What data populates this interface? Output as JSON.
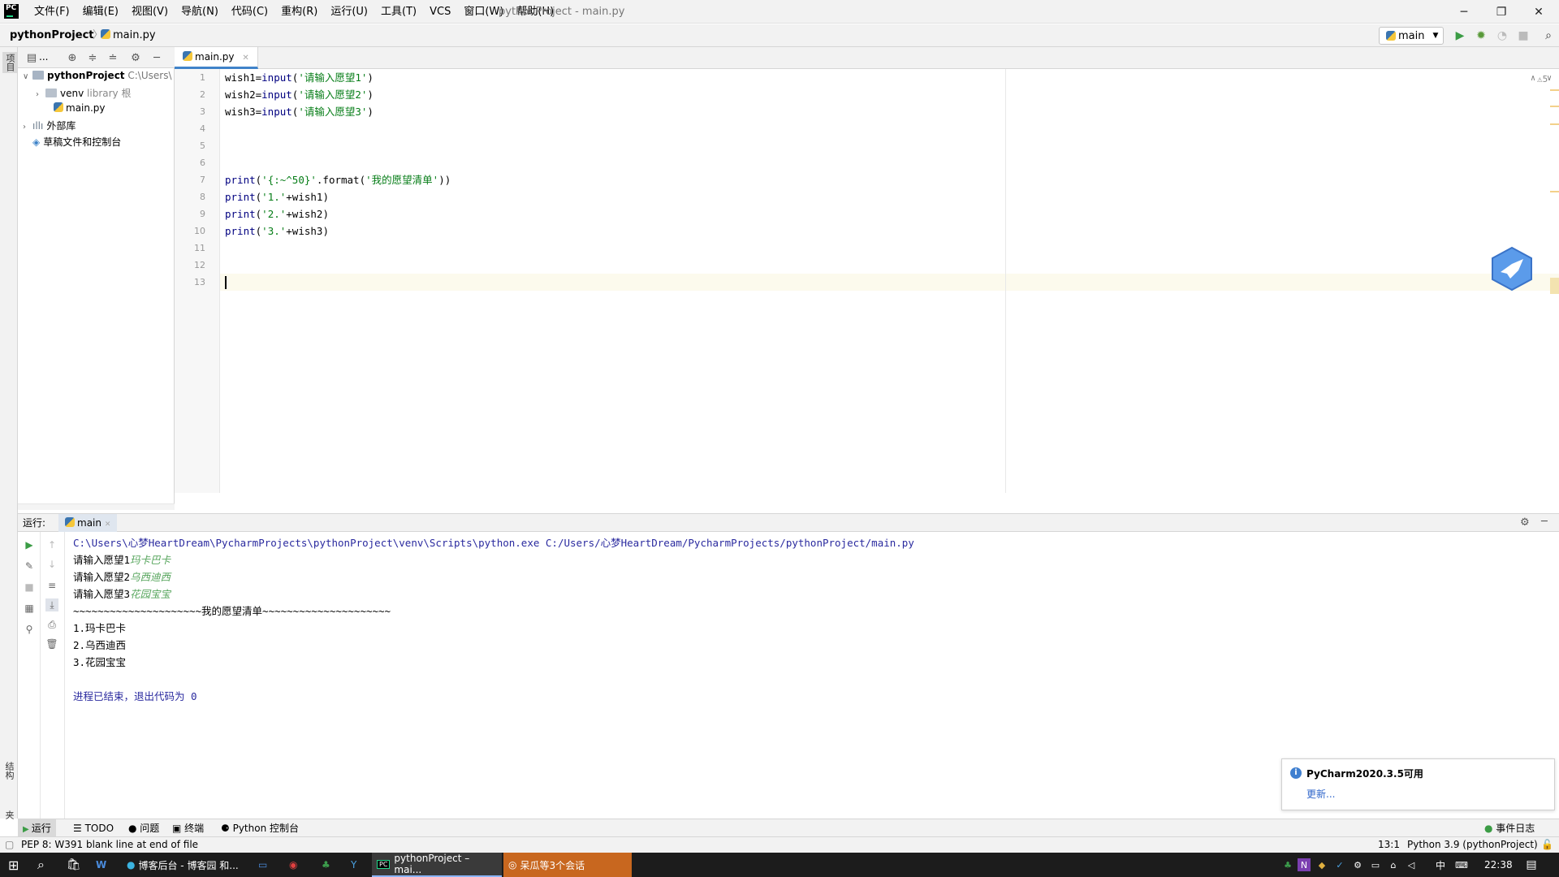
{
  "window": {
    "title": "pythonProject - main.py",
    "menu": [
      "文件(F)",
      "编辑(E)",
      "视图(V)",
      "导航(N)",
      "代码(C)",
      "重构(R)",
      "运行(U)",
      "工具(T)",
      "VCS",
      "窗口(W)",
      "帮助(H)"
    ],
    "controls": {
      "minimize": "─",
      "restore": "❐",
      "close": "✕"
    }
  },
  "nav": {
    "project": "pythonProject",
    "separator": "〉",
    "file": "main.py",
    "run_config": "main"
  },
  "left_stripe": {
    "project_tab": "项目",
    "structure_tab": "结构",
    "favorites_tab": "收藏夹"
  },
  "project_tree": {
    "toolbar_dots": "...",
    "root_name": "pythonProject",
    "root_path": "C:\\Users\\",
    "venv": "venv",
    "venv_tag": "library 根",
    "main_file": "main.py",
    "external_libs": "外部库",
    "scratches": "草稿文件和控制台"
  },
  "editor": {
    "tab_label": "main.py",
    "line_numbers": [
      "1",
      "2",
      "3",
      "4",
      "5",
      "6",
      "7",
      "8",
      "9",
      "10",
      "11",
      "12",
      "13"
    ],
    "lines": [
      {
        "a": "wish1=",
        "b": "input",
        "c": "(",
        "d": "'请输入愿望1'",
        "e": ")"
      },
      {
        "a": "wish2=",
        "b": "input",
        "c": "(",
        "d": "'请输入愿望2'",
        "e": ")"
      },
      {
        "a": "wish3=",
        "b": "input",
        "c": "(",
        "d": "'请输入愿望3'",
        "e": ")"
      }
    ],
    "print_lines": [
      {
        "fn": "print",
        "p1": "(",
        "s1": "'{:~^50}'",
        "m": ".format(",
        "s2": "'我的愿望清单'",
        "end": "))"
      },
      {
        "fn": "print",
        "p1": "(",
        "s1": "'1.'",
        "m": "+wish1",
        "s2": "",
        "end": ")"
      },
      {
        "fn": "print",
        "p1": "(",
        "s1": "'2.'",
        "m": "+wish2",
        "s2": "",
        "end": ")"
      },
      {
        "fn": "print",
        "p1": "(",
        "s1": "'3.'",
        "m": "+wish3",
        "s2": "",
        "end": ")"
      }
    ],
    "warning_count": "⚠5",
    "cursor_position": "13:1"
  },
  "run": {
    "label": "运行:",
    "tab": "main",
    "command": "C:\\Users\\心梦HeartDream\\PycharmProjects\\pythonProject\\venv\\Scripts\\python.exe C:/Users/心梦HeartDream/PycharmProjects/pythonProject/main.py",
    "prompts": [
      {
        "prompt": "请输入愿望1",
        "input": "玛卡巴卡"
      },
      {
        "prompt": "请输入愿望2",
        "input": "乌西迪西"
      },
      {
        "prompt": "请输入愿望3",
        "input": "花园宝宝"
      }
    ],
    "banner": "~~~~~~~~~~~~~~~~~~~~~我的愿望清单~~~~~~~~~~~~~~~~~~~~~",
    "results": [
      "1.玛卡巴卡",
      "2.乌西迪西",
      "3.花园宝宝"
    ],
    "finished": "进程已结束，退出代码为 0"
  },
  "notification": {
    "title": "PyCharm2020.3.5可用",
    "link": "更新..."
  },
  "bottom_tools": {
    "run": "运行",
    "todo": "TODO",
    "problems": "问题",
    "terminal": "终端",
    "python_console": "Python 控制台",
    "event_log": "事件日志"
  },
  "status": {
    "message": "PEP 8: W391 blank line at end of file",
    "position": "13:1",
    "interpreter": "Python 3.9 (pythonProject)"
  },
  "taskbar": {
    "app1": "博客后台 - 博客园 和...",
    "app2": "pythonProject – mai...",
    "app3": "呆瓜等3个会话",
    "ime": "中",
    "time": "22:38"
  }
}
